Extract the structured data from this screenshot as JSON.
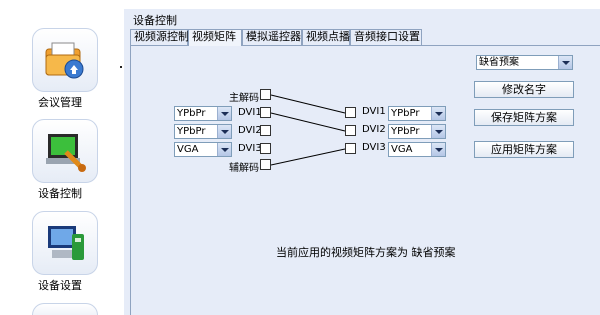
{
  "sidebar": {
    "items": [
      {
        "label": "会议管理",
        "icon": "meeting-folder-icon"
      },
      {
        "label": "设备控制",
        "icon": "device-control-icon"
      },
      {
        "label": "设备设置",
        "icon": "device-settings-icon"
      }
    ]
  },
  "main": {
    "title": "设备控制",
    "tabs": [
      "视频源控制",
      "视频矩阵",
      "模拟遥控器",
      "视频点播",
      "音频接口设置"
    ],
    "active_tab": "视频矩阵"
  },
  "matrix": {
    "preset_select": "缺省预案",
    "buttons": {
      "rename": "修改名字",
      "save": "保存矩阵方案",
      "apply": "应用矩阵方案"
    },
    "inputs": [
      {
        "label": "主解码",
        "format": null
      },
      {
        "label": "DVI1",
        "format": "YPbPr"
      },
      {
        "label": "DVI2",
        "format": "YPbPr"
      },
      {
        "label": "DVI3",
        "format": "VGA"
      },
      {
        "label": "辅解码",
        "format": null
      }
    ],
    "outputs": [
      {
        "label": "DVI1",
        "format": "YPbPr"
      },
      {
        "label": "DVI2",
        "format": "YPbPr"
      },
      {
        "label": "DVI3",
        "format": "VGA"
      }
    ],
    "status_text": "当前应用的视频矩阵方案为 缺省预案"
  }
}
